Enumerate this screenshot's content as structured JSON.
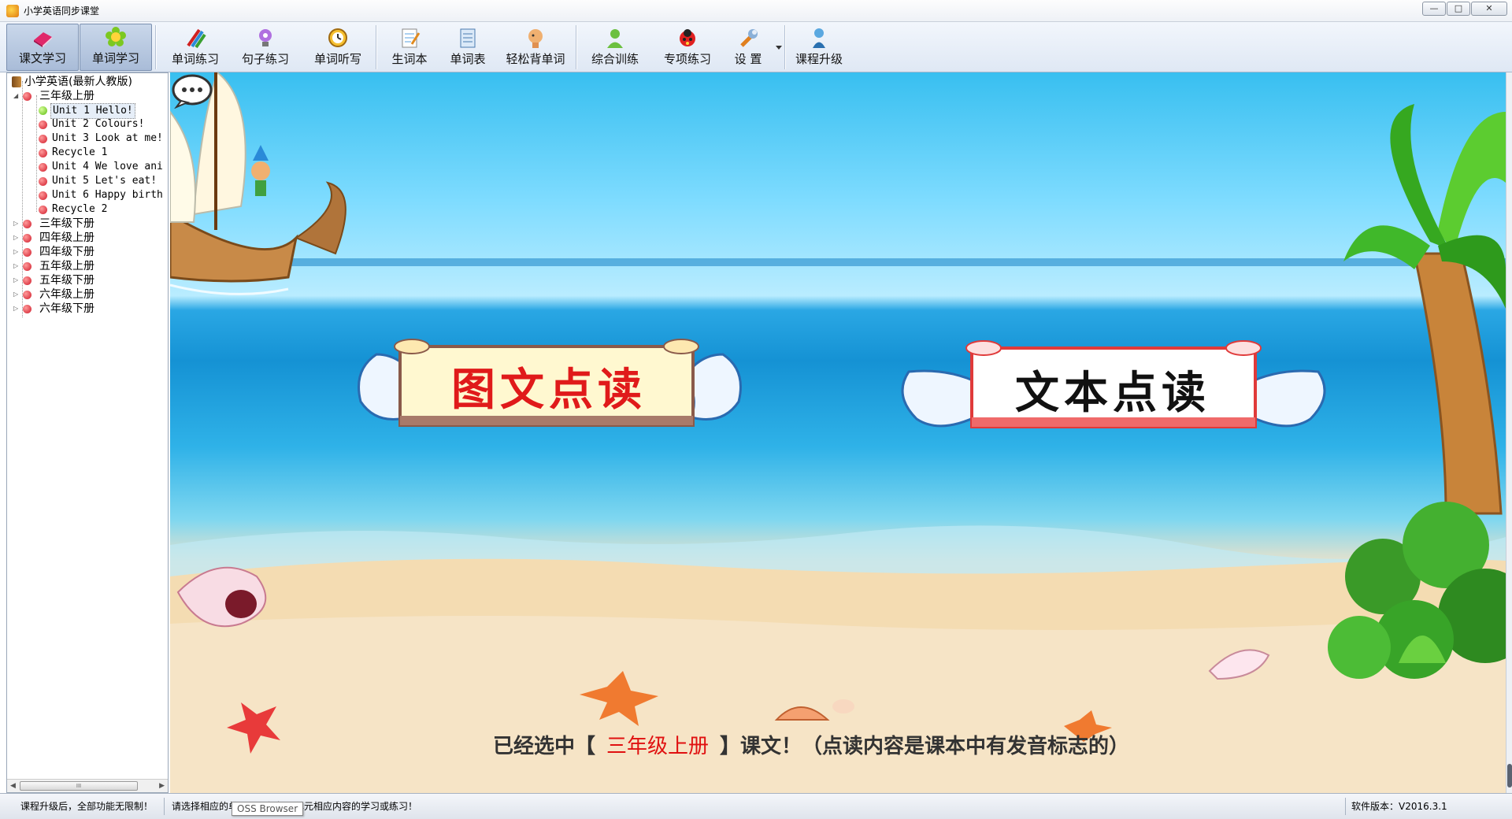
{
  "window": {
    "title": "小学英语同步课堂",
    "controls": {
      "minimize": "—",
      "maximize": "□",
      "close": "✕"
    }
  },
  "toolbar": {
    "buttons": [
      {
        "label": "课文学习",
        "icon": "book-icon",
        "active": true
      },
      {
        "label": "单词学习",
        "icon": "flower-icon",
        "active": true
      },
      {
        "label": "单词练习",
        "icon": "pencils-icon",
        "active": false
      },
      {
        "label": "句子练习",
        "icon": "lightbulb-icon",
        "active": false
      },
      {
        "label": "单词听写",
        "icon": "clock-icon",
        "active": false
      },
      {
        "label": "生词本",
        "icon": "notepad-icon",
        "active": false
      },
      {
        "label": "单词表",
        "icon": "list-icon",
        "active": false
      },
      {
        "label": "轻松背单词",
        "icon": "thinking-head-icon",
        "active": false
      },
      {
        "label": "综合训练",
        "icon": "person-icon",
        "active": false
      },
      {
        "label": "专项练习",
        "icon": "ladybug-icon",
        "active": false
      },
      {
        "label": "设  置",
        "icon": "wrench-icon",
        "active": false
      },
      {
        "label": "课程升级",
        "icon": "upgrade-person-icon",
        "active": false
      }
    ]
  },
  "tree": {
    "root": "小学英语(最新人教版)",
    "expanded_grade": "三年级上册",
    "units": [
      {
        "label": "Unit 1 Hello!",
        "selected": true
      },
      {
        "label": "Unit 2 Colours!",
        "selected": false
      },
      {
        "label": "Unit 3 Look at me!",
        "selected": false
      },
      {
        "label": "Recycle 1",
        "selected": false
      },
      {
        "label": "Unit 4 We love ani",
        "selected": false
      },
      {
        "label": "Unit 5 Let's eat!",
        "selected": false
      },
      {
        "label": "Unit 6 Happy birth",
        "selected": false
      },
      {
        "label": "Recycle 2",
        "selected": false
      }
    ],
    "collapsed_grades": [
      "三年级下册",
      "四年级上册",
      "四年级下册",
      "五年级上册",
      "五年级下册",
      "六年级上册",
      "六年级下册"
    ],
    "scroll_thumb_grip": "III"
  },
  "main": {
    "picture_reading_label": "图文点读",
    "text_reading_label": "文本点读",
    "hint_prefix": "已经选中【",
    "hint_selected": "三年级上册",
    "hint_suffix": "】课文！（点读内容是课本中有发音标志的）"
  },
  "statusbar": {
    "upgrade_note": "课程升级后，全部功能无限制！",
    "instruction": "请选择相应的单元，进行每个单元相应内容的学习或练习！",
    "version": "软件版本：V2016.3.1",
    "tooltip": "OSS Browser"
  },
  "colors": {
    "picture_reading_text": "#e01a1a",
    "text_reading_text": "#111111",
    "hint_highlight": "#e01010",
    "sea": "#1592d4",
    "sand": "#f3ddb8"
  }
}
